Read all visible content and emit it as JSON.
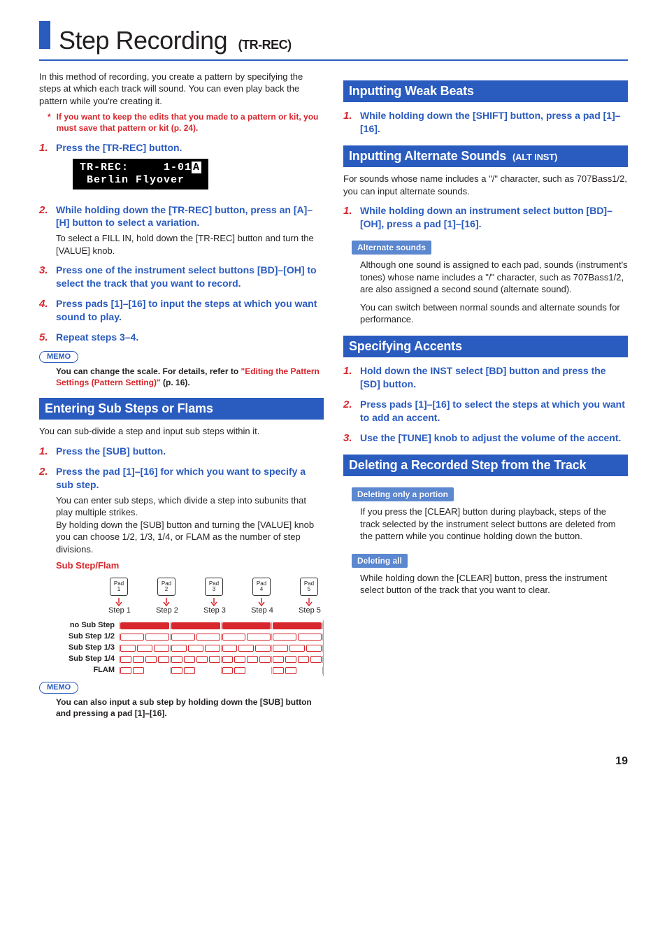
{
  "page": {
    "title": "Step Recording",
    "title_sub": "(TR-REC)",
    "number": "19"
  },
  "left": {
    "intro": "In this method of recording, you create a pattern by specifying the steps at which each track will sound. You can even play back the pattern while you're creating it.",
    "note": "If you want to keep the edits that you made to a pattern or kit, you must save that pattern or kit (p. 24).",
    "steps": [
      {
        "head": "Press the [TR-REC] button."
      },
      {
        "head": "While holding down the [TR-REC] button, press an [A]–[H] button to select a variation.",
        "body": "To select a FILL IN, hold down the [TR-REC] button and turn the [VALUE] knob."
      },
      {
        "head": "Press one of the instrument select buttons [BD]–[OH] to select the track that you want to record."
      },
      {
        "head": "Press pads [1]–[16] to input the steps at which you want sound to play."
      },
      {
        "head": "Repeat steps 3–4."
      }
    ],
    "lcd_line1": "TR-REC:     1-01",
    "lcd_line2": " Berlin Flyover",
    "memo1_label": "MEMO",
    "memo1_body_a": "You can change the scale. For details, refer to ",
    "memo1_link": "\"Editing the Pattern Settings (Pattern Setting)\"",
    "memo1_body_b": " (p. 16).",
    "section_sub": "Entering Sub Steps or Flams",
    "sub_intro": "You can sub-divide a step and input sub steps within it.",
    "sub_steps": [
      {
        "head": "Press the [SUB] button."
      },
      {
        "head": "Press the pad [1]–[16] for which you want to specify a sub step.",
        "body": "You can enter sub steps, which divide a step into subunits that play multiple strikes.\nBy holding down the [SUB] button and turning the [VALUE] knob you can choose 1/2, 1/3, 1/4, or FLAM as the number of step divisions."
      }
    ],
    "diagram": {
      "title": "Sub Step/Flam",
      "pads": [
        "Pad\n1",
        "Pad\n2",
        "Pad\n3",
        "Pad\n4",
        "Pad\n5"
      ],
      "labels": [
        "Step 1",
        "Step 2",
        "Step 3",
        "Step 4",
        "Step 5"
      ],
      "rows": [
        "no Sub Step",
        "Sub Step 1/2",
        "Sub Step 1/3",
        "Sub Step 1/4",
        "FLAM"
      ]
    },
    "memo2_label": "MEMO",
    "memo2_body": "You can also input a sub step by holding down the [SUB] button and pressing a pad [1]–[16]."
  },
  "right": {
    "sec_weak": "Inputting Weak Beats",
    "weak_steps": [
      {
        "head": "While holding down the [SHIFT] button, press a pad [1]–[16]."
      }
    ],
    "sec_alt": "Inputting Alternate Sounds",
    "sec_alt_sub": "(ALT INST)",
    "alt_intro": "For sounds whose name includes a \"/\" character, such as 707Bass1/2, you can input alternate sounds.",
    "alt_steps": [
      {
        "head": "While holding down an instrument select button [BD]–[OH], press a pad [1]–[16]."
      }
    ],
    "alt_callout_label": "Alternate sounds",
    "alt_callout_body1": "Although one sound is assigned to each pad, sounds (instrument's tones) whose name includes a \"/\" character, such as 707Bass1/2, are also assigned a second sound (alternate sound).",
    "alt_callout_body2": "You can switch between normal sounds and alternate sounds for performance.",
    "sec_acc": "Specifying Accents",
    "acc_steps": [
      {
        "head": "Hold down the INST select [BD] button and press the [SD] button."
      },
      {
        "head": "Press pads [1]–[16] to select the steps at which you want to add an accent."
      },
      {
        "head": "Use the [TUNE] knob to adjust the volume of the accent."
      }
    ],
    "sec_del": "Deleting a Recorded Step from the Track",
    "del_portion_label": "Deleting only a portion",
    "del_portion_body": "If you press the [CLEAR] button during playback, steps of the track selected by the instrument select buttons are deleted from the pattern while you continue holding down the button.",
    "del_all_label": "Deleting all",
    "del_all_body": "While holding down the [CLEAR] button, press the instrument select button of the track that you want to clear."
  }
}
